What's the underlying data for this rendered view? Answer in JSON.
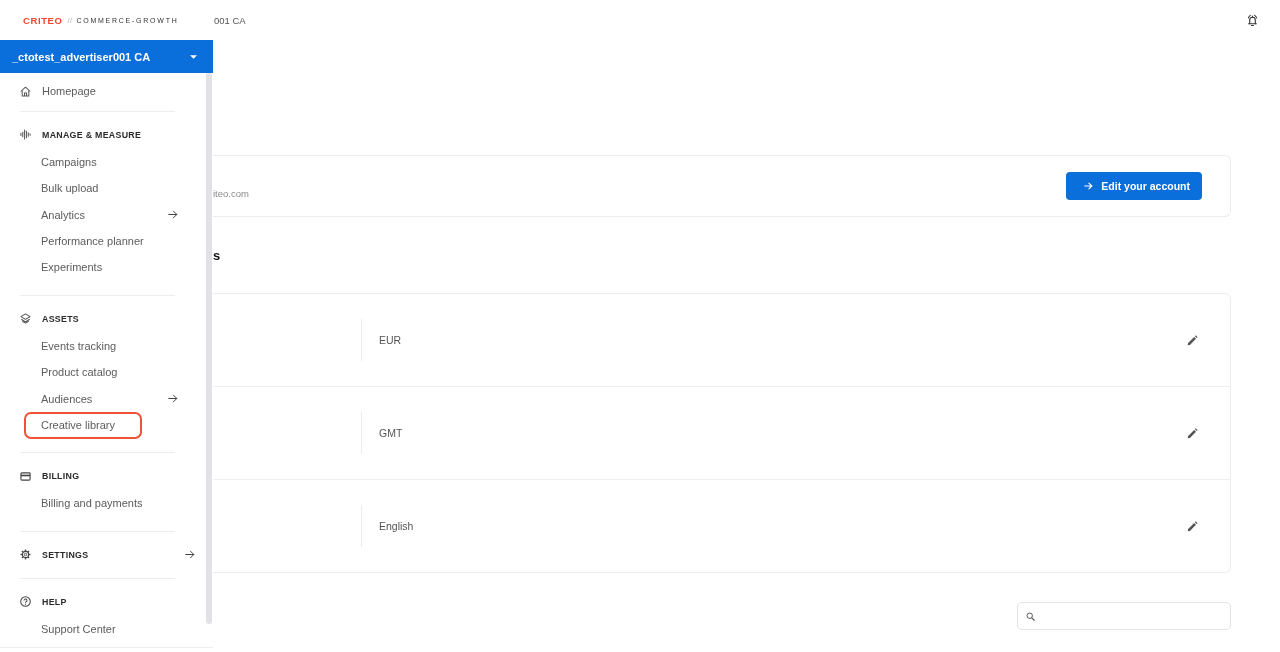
{
  "logo": {
    "brand": "CRITEO",
    "separator": "//",
    "product": "COMMERCE-GROWTH"
  },
  "account_selector": {
    "label": "_ctotest_advertiser001 CA"
  },
  "sidebar": {
    "home": {
      "label": "Homepage"
    },
    "sections": [
      {
        "title": "MANAGE & MEASURE",
        "submenu": false,
        "items": [
          {
            "label": "Campaigns",
            "submenu": false,
            "highlighted": false
          },
          {
            "label": "Bulk upload",
            "submenu": false,
            "highlighted": false
          },
          {
            "label": "Analytics",
            "submenu": true,
            "highlighted": false
          },
          {
            "label": "Performance planner",
            "submenu": false,
            "highlighted": false
          },
          {
            "label": "Experiments",
            "submenu": false,
            "highlighted": false
          }
        ]
      },
      {
        "title": "ASSETS",
        "submenu": false,
        "items": [
          {
            "label": "Events tracking",
            "submenu": false,
            "highlighted": false
          },
          {
            "label": "Product catalog",
            "submenu": false,
            "highlighted": false
          },
          {
            "label": "Audiences",
            "submenu": true,
            "highlighted": false
          },
          {
            "label": "Creative library",
            "submenu": false,
            "highlighted": true
          }
        ]
      },
      {
        "title": "BILLING",
        "submenu": false,
        "items": [
          {
            "label": "Billing and payments",
            "submenu": false,
            "highlighted": false
          }
        ]
      },
      {
        "title": "SETTINGS",
        "submenu": true
      },
      {
        "title": "HELP",
        "submenu": false,
        "items": [
          {
            "label": "Support Center",
            "submenu": false,
            "highlighted": false
          }
        ]
      }
    ]
  },
  "header": {
    "breadcrumb": "001 CA"
  },
  "account_card": {
    "email": "iteo.com",
    "button": "Edit your account"
  },
  "settings": {
    "heading": "s",
    "rows": [
      {
        "value": "EUR"
      },
      {
        "value": "GMT"
      },
      {
        "value": "English"
      }
    ]
  }
}
